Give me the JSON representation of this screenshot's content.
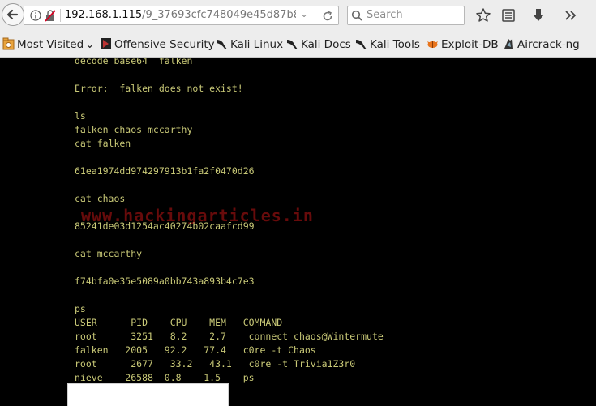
{
  "browser": {
    "url_host": "192.168.1.115",
    "url_path": "/9_37693cfc748049e45d87b8",
    "search_placeholder": "Search"
  },
  "bookmarks": [
    {
      "label": "Most Visited",
      "icon": "most-visited-icon",
      "has_dropdown": true
    },
    {
      "label": "Offensive Security",
      "icon": "offsec-icon"
    },
    {
      "label": "Kali Linux",
      "icon": "kali-linux-icon"
    },
    {
      "label": "Kali Docs",
      "icon": "kali-docs-icon"
    },
    {
      "label": "Kali Tools",
      "icon": "kali-tools-icon"
    },
    {
      "label": "Exploit-DB",
      "icon": "exploit-db-icon"
    },
    {
      "label": "Aircrack-ng",
      "icon": "aircrack-ng-icon"
    }
  ],
  "terminal": {
    "text_color": "#c9c977",
    "background": "#000000",
    "lines": [
      "decode base64  falken",
      "",
      "Error:  falken does not exist!",
      "",
      "ls",
      "falken chaos mccarthy",
      "cat falken",
      "",
      "61ea1974dd974297913b1fa2f0470d26",
      "",
      "cat chaos",
      "",
      "85241de03d1254ac40274b02caafcd99",
      "",
      "cat mccarthy",
      "",
      "f74bfa0e35e5089a0bb743a893b4c7e3",
      "",
      "ps",
      "USER      PID    CPU    MEM   COMMAND",
      "root      3251   8.2    2.7    connect chaos@Wintermute",
      "falken   2005   92.2   77.4   c0re -t Chaos",
      "root      2677   33.2   43.1   c0re -t Trivia1Z3r0",
      "nieve    26588  0.8    1.5    ps"
    ]
  },
  "watermark": "www.hackingarticles.in"
}
